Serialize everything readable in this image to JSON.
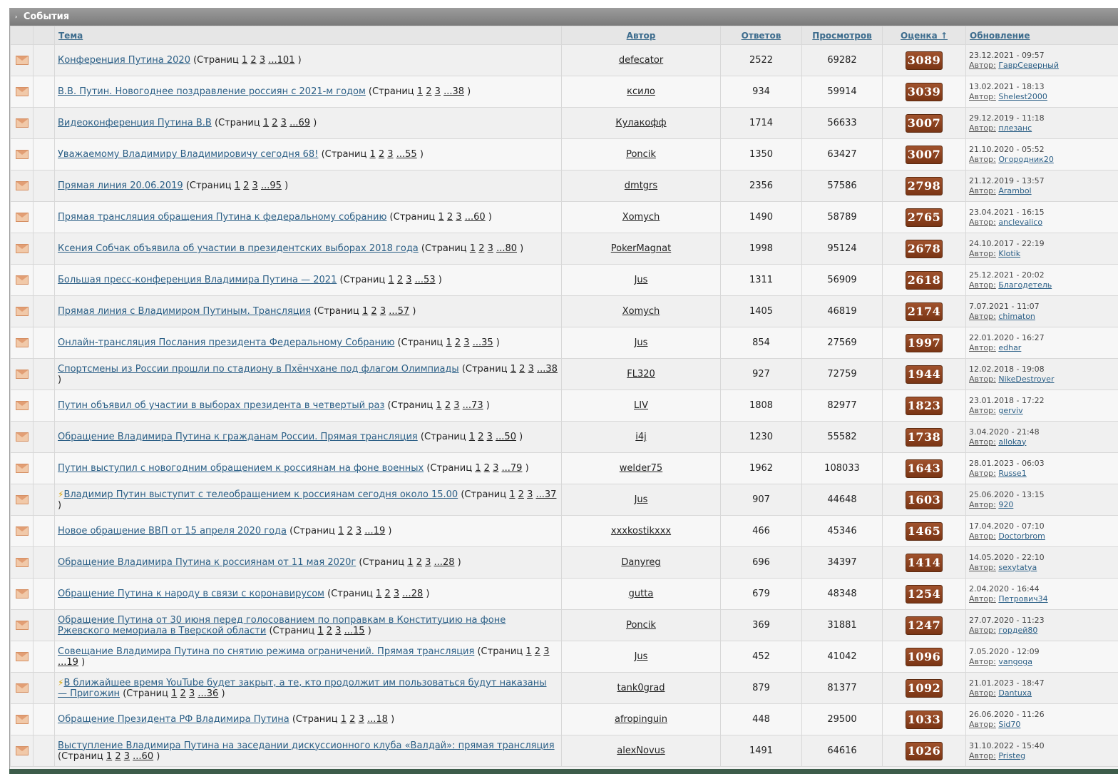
{
  "category": {
    "title": "События",
    "arrow": "›"
  },
  "columns": {
    "topic": "Тема",
    "author": "Автор",
    "replies": "Ответов",
    "views": "Просмотров",
    "rating": "Оценка ↑",
    "updated": "Обновление"
  },
  "labels": {
    "pages_prefix": "(Страниц",
    "pages_suffix": ")",
    "author_prefix": "Автор:"
  },
  "topics": [
    {
      "title": "Конференция Путина 2020",
      "lightning": false,
      "pages": [
        "1",
        "2",
        "3",
        "...101"
      ],
      "author": "defecator",
      "replies": "2522",
      "views": "69282",
      "rating": "3089",
      "date": "23.12.2021 - 09:57",
      "last_author": "ГаврСеверный"
    },
    {
      "title": "В.В. Путин. Новогоднее поздравление россиян с 2021-м годом",
      "lightning": false,
      "pages": [
        "1",
        "2",
        "3",
        "...38"
      ],
      "author": "ксило",
      "replies": "934",
      "views": "59914",
      "rating": "3039",
      "date": "13.02.2021 - 18:13",
      "last_author": "Shelest2000"
    },
    {
      "title": "Видеоконференция Путина В.В",
      "lightning": false,
      "pages": [
        "1",
        "2",
        "3",
        "...69"
      ],
      "author": "Кулакофф",
      "replies": "1714",
      "views": "56633",
      "rating": "3007",
      "date": "29.12.2019 - 11:18",
      "last_author": "плезанс"
    },
    {
      "title": "Уважаемому Владимиру Владимировичу сегодня 68!",
      "lightning": false,
      "pages": [
        "1",
        "2",
        "3",
        "...55"
      ],
      "author": "Poncik",
      "replies": "1350",
      "views": "63427",
      "rating": "3007",
      "date": "21.10.2020 - 05:52",
      "last_author": "Огородник20"
    },
    {
      "title": "Прямая линия 20.06.2019",
      "lightning": false,
      "pages": [
        "1",
        "2",
        "3",
        "...95"
      ],
      "author": "dmtgrs",
      "replies": "2356",
      "views": "57586",
      "rating": "2798",
      "date": "21.12.2019 - 13:57",
      "last_author": "Arambol"
    },
    {
      "title": "Прямая трансляция обращения Путина к федеральному собранию",
      "lightning": false,
      "pages": [
        "1",
        "2",
        "3",
        "...60"
      ],
      "author": "Xomych",
      "replies": "1490",
      "views": "58789",
      "rating": "2765",
      "date": "23.04.2021 - 16:15",
      "last_author": "anclevalico"
    },
    {
      "title": "Ксения Собчак объявила об участии в президентских выборах 2018 года",
      "lightning": false,
      "pages": [
        "1",
        "2",
        "3",
        "...80"
      ],
      "author": "PokerMagnat",
      "replies": "1998",
      "views": "95124",
      "rating": "2678",
      "date": "24.10.2017 - 22:19",
      "last_author": "Klotik"
    },
    {
      "title": "Большая пресс-конференция Владимира Путина — 2021",
      "lightning": false,
      "pages": [
        "1",
        "2",
        "3",
        "...53"
      ],
      "author": "Jus",
      "replies": "1311",
      "views": "56909",
      "rating": "2618",
      "date": "25.12.2021 - 20:02",
      "last_author": "Благодетель"
    },
    {
      "title": "Прямая линия с Владимиром Путиным. Трансляция",
      "lightning": false,
      "pages": [
        "1",
        "2",
        "3",
        "...57"
      ],
      "author": "Xomych",
      "replies": "1405",
      "views": "46819",
      "rating": "2174",
      "date": "7.07.2021 - 11:07",
      "last_author": "chimaton"
    },
    {
      "title": "Онлайн-трансляция Послания президента Федеральному Собранию",
      "lightning": false,
      "pages": [
        "1",
        "2",
        "3",
        "...35"
      ],
      "author": "Jus",
      "replies": "854",
      "views": "27569",
      "rating": "1997",
      "date": "22.01.2020 - 16:27",
      "last_author": "edhar"
    },
    {
      "title": "Спортсмены из России прошли по стадиону в Пхёнчхане под флагом Олимпиады",
      "lightning": false,
      "pages": [
        "1",
        "2",
        "3",
        "...38"
      ],
      "author": "FL320",
      "replies": "927",
      "views": "72759",
      "rating": "1944",
      "date": "12.02.2018 - 19:08",
      "last_author": "NikeDestroyer"
    },
    {
      "title": "Путин объявил об участии в выборах президента в четвертый раз",
      "lightning": false,
      "pages": [
        "1",
        "2",
        "3",
        "...73"
      ],
      "author": "LIV",
      "replies": "1808",
      "views": "82977",
      "rating": "1823",
      "date": "23.01.2018 - 17:22",
      "last_author": "gerviv"
    },
    {
      "title": "Обращение Владимира Путина к гражданам России. Прямая трансляция",
      "lightning": false,
      "pages": [
        "1",
        "2",
        "3",
        "...50"
      ],
      "author": "i4j",
      "replies": "1230",
      "views": "55582",
      "rating": "1738",
      "date": "3.04.2020 - 21:48",
      "last_author": "allokay"
    },
    {
      "title": "Путин выступил с новогодним обращением к россиянам на фоне военных",
      "lightning": false,
      "pages": [
        "1",
        "2",
        "3",
        "...79"
      ],
      "author": "welder75",
      "replies": "1962",
      "views": "108033",
      "rating": "1643",
      "date": "28.01.2023 - 06:03",
      "last_author": "Russe1"
    },
    {
      "title": "Владимир Путин выступит с телеобращением к россиянам сегодня около 15.00",
      "lightning": true,
      "pages": [
        "1",
        "2",
        "3",
        "...37"
      ],
      "author": "Jus",
      "replies": "907",
      "views": "44648",
      "rating": "1603",
      "date": "25.06.2020 - 13:15",
      "last_author": "920"
    },
    {
      "title": "Новое обращение ВВП от 15 апреля 2020 года",
      "lightning": false,
      "pages": [
        "1",
        "2",
        "3",
        "...19"
      ],
      "author": "xxxkostikxxx",
      "replies": "466",
      "views": "45346",
      "rating": "1465",
      "date": "17.04.2020 - 07:10",
      "last_author": "Doctorbrom"
    },
    {
      "title": "Обращение Владимира Путина к россиянам от 11 мая 2020г",
      "lightning": false,
      "pages": [
        "1",
        "2",
        "3",
        "...28"
      ],
      "author": "Danyreg",
      "replies": "696",
      "views": "34397",
      "rating": "1414",
      "date": "14.05.2020 - 22:10",
      "last_author": "sexytatya"
    },
    {
      "title": "Обращение Путина к народу в связи с коронавирусом",
      "lightning": false,
      "pages": [
        "1",
        "2",
        "3",
        "...28"
      ],
      "author": "gutta",
      "replies": "679",
      "views": "48348",
      "rating": "1254",
      "date": "2.04.2020 - 16:44",
      "last_author": "Петрович34"
    },
    {
      "title": "Обращение Путина от 30 июня перед голосованием по поправкам в Конституцию на фоне Ржевского мемориала в Тверской области",
      "lightning": false,
      "pages": [
        "1",
        "2",
        "3",
        "...15"
      ],
      "author": "Poncik",
      "replies": "369",
      "views": "31881",
      "rating": "1247",
      "date": "27.07.2020 - 11:23",
      "last_author": "гордей80"
    },
    {
      "title": "Совещание Владимира Путина по снятию режима ограничений. Прямая трансляция",
      "lightning": false,
      "pages": [
        "1",
        "2",
        "3",
        "...19"
      ],
      "author": "Jus",
      "replies": "452",
      "views": "41042",
      "rating": "1096",
      "date": "7.05.2020 - 12:09",
      "last_author": "vangoga"
    },
    {
      "title": "В ближайшее время YouTube будет закрыт, а те, кто продолжит им пользоваться будут наказаны — Пригожин",
      "lightning": true,
      "pages": [
        "1",
        "2",
        "3",
        "...36"
      ],
      "author": "tank0grad",
      "replies": "879",
      "views": "81377",
      "rating": "1092",
      "date": "21.01.2023 - 18:47",
      "last_author": "Dantuxa"
    },
    {
      "title": "Обращение Президента РФ Владимира Путина",
      "lightning": false,
      "pages": [
        "1",
        "2",
        "3",
        "...18"
      ],
      "author": "afropinguin",
      "replies": "448",
      "views": "29500",
      "rating": "1033",
      "date": "26.06.2020 - 11:26",
      "last_author": "Sid70"
    },
    {
      "title": "Выступление Владимира Путина на заседании дискуссионного клуба «Валдай»: прямая трансляция",
      "lightning": false,
      "pages": [
        "1",
        "2",
        "3",
        "...60"
      ],
      "author": "alexNovus",
      "replies": "1491",
      "views": "64616",
      "rating": "1026",
      "date": "31.10.2022 - 15:40",
      "last_author": "Pristeg"
    }
  ]
}
